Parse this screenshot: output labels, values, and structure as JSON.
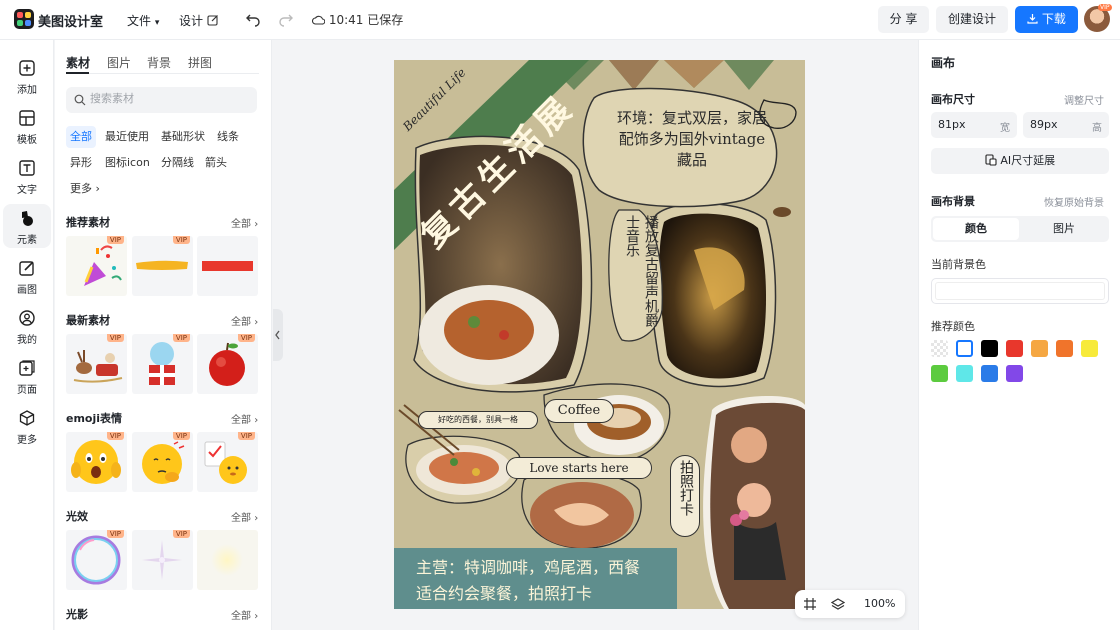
{
  "app": {
    "title": "美图设计室"
  },
  "topbar": {
    "file_menu": "文件",
    "design_menu": "设计",
    "save_status": "10:41 已保存",
    "share_label": "分 享",
    "create_label": "创建设计",
    "download_label": "下载",
    "avatar_badge": "VIP"
  },
  "leftbar": {
    "items": [
      {
        "label": "添加",
        "icon": "plus-square-icon"
      },
      {
        "label": "模板",
        "icon": "template-icon"
      },
      {
        "label": "文字",
        "icon": "text-icon"
      },
      {
        "label": "元素",
        "icon": "shapes-icon"
      },
      {
        "label": "画图",
        "icon": "draw-icon"
      },
      {
        "label": "我的",
        "icon": "user-icon"
      },
      {
        "label": "页面",
        "icon": "page-add-icon"
      },
      {
        "label": "更多",
        "icon": "cube-icon"
      }
    ],
    "active_index": 3
  },
  "panel": {
    "tabs": [
      "素材",
      "图片",
      "背景",
      "拼图"
    ],
    "active_tab": 0,
    "search_placeholder": "搜索素材",
    "chips": [
      "全部",
      "最近使用",
      "基础形状",
      "线条",
      "异形",
      "图标icon",
      "分隔线",
      "箭头",
      "更多"
    ],
    "active_chip": 0,
    "sections": [
      {
        "title": "推荐素材",
        "all": "全部",
        "thumbs": [
          "party-popper",
          "yellow-brush-stroke",
          "red-bar"
        ]
      },
      {
        "title": "最新素材",
        "all": "全部",
        "thumbs": [
          "christmas-sleigh",
          "snow-globe-gift",
          "red-apple"
        ]
      },
      {
        "title": "emoji表情",
        "all": "全部",
        "thumbs": [
          "shocked-emoji",
          "thinking-emoji",
          "checklist-emoji"
        ]
      },
      {
        "title": "光效",
        "all": "全部",
        "thumbs": [
          "bubble-ring",
          "sparkle-star",
          "glow-dot"
        ]
      },
      {
        "title": "光影",
        "all": "全部",
        "thumbs": []
      }
    ],
    "vip_label": "VIP"
  },
  "poster": {
    "banner_text": "复古生活展",
    "script_text": "Beautiful Life",
    "env_text": "环境：复式双层，家居配饰多为国外vintage藏品",
    "music_text": "播放复古留声机爵士音乐",
    "coffee_label": "Coffee",
    "meal_text": "好吃的西餐，别具一格",
    "love_text": "Love starts here",
    "photo_text": "拍照打卡",
    "bottom_text_1": "主营：特调咖啡，鸡尾酒，西餐",
    "bottom_text_2": "适合约会聚餐，拍照打卡"
  },
  "zoom": {
    "value": "100%"
  },
  "rpanel": {
    "title": "画布",
    "size_label": "画布尺寸",
    "size_link": "调整尺寸",
    "width_value": "81px",
    "width_unit": "宽",
    "height_value": "89px",
    "height_unit": "高",
    "ai_button": "AI尺寸延展",
    "bg_label": "画布背景",
    "bg_link": "恢复原始背景",
    "seg_color": "颜色",
    "seg_image": "图片",
    "current_color_label": "当前背景色",
    "recommend_label": "推荐颜色",
    "swatches": [
      "transparent",
      "#ffffff",
      "#000000",
      "#e8372c",
      "#f5a742",
      "#f0742b",
      "#f7ea3a",
      "#5ccb3f",
      "#5fe7e8",
      "#2a7be8",
      "#8248e8"
    ]
  },
  "colors": {
    "accent": "#1677ff",
    "poster_bg": "#c8bd97",
    "banner_green": "#4e7d4d",
    "bottom_teal": "#5f8e8d"
  }
}
